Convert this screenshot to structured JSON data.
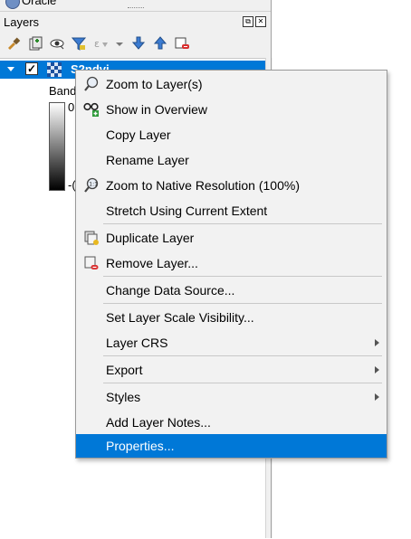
{
  "dock": {
    "above_label": "Oracle",
    "title": "Layers",
    "toolbar_icons": [
      "style-panel-icon",
      "add-group-icon",
      "manage-visibility-icon",
      "filter-legend-icon",
      "filter-expression-icon",
      "expand-all-icon",
      "collapse-all-icon",
      "remove-layer-icon"
    ],
    "float_symbol": "⧉",
    "close_symbol": "✕"
  },
  "layer": {
    "name": "S2ndvi",
    "checked_symbol": "✓",
    "band_label": "Band",
    "ramp_max": "0",
    "ramp_min": "-("
  },
  "context_menu": {
    "items": [
      {
        "label": "Zoom to Layer(s)",
        "icon": "zoom-layer-icon"
      },
      {
        "label": "Show in Overview",
        "icon": "overview-icon"
      },
      {
        "label": "Copy Layer"
      },
      {
        "label": "Rename Layer"
      },
      {
        "label": "Zoom to Native Resolution (100%)",
        "icon": "zoom-native-icon"
      },
      {
        "label": "Stretch Using Current Extent"
      },
      {
        "label": "Duplicate Layer",
        "icon": "duplicate-icon"
      },
      {
        "label": "Remove Layer...",
        "icon": "remove-icon"
      },
      {
        "label": "Change Data Source..."
      },
      {
        "label": "Set Layer Scale Visibility..."
      },
      {
        "label": "Layer CRS",
        "submenu": true
      },
      {
        "label": "Export",
        "submenu": true
      },
      {
        "label": "Styles",
        "submenu": true
      },
      {
        "label": "Add Layer Notes..."
      },
      {
        "label": "Properties...",
        "highlighted": true
      }
    ],
    "colors": {
      "highlight": "#0078d7",
      "background": "#f2f2f2"
    }
  }
}
